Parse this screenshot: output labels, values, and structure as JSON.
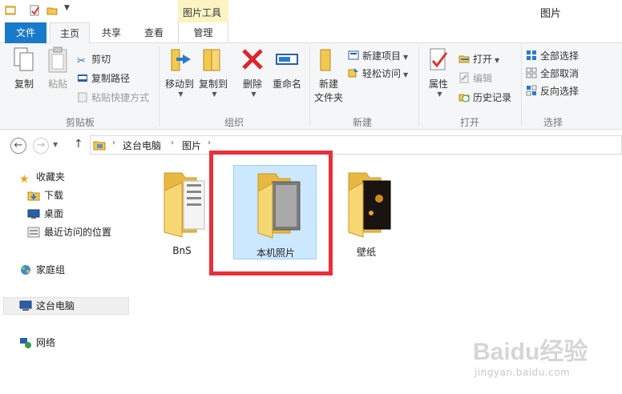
{
  "window": {
    "title": "图片",
    "context_tab_group": "图片工具"
  },
  "tabs": {
    "file": "文件",
    "home": "主页",
    "share": "共享",
    "view": "查看",
    "manage": "管理"
  },
  "ribbon": {
    "clipboard": {
      "label": "剪贴板",
      "copy": "复制",
      "paste": "粘贴",
      "cut": "剪切",
      "copy_path": "复制路径",
      "paste_shortcut": "粘贴快捷方式"
    },
    "organize": {
      "label": "组织",
      "move_to": "移动到",
      "copy_to": "复制到",
      "delete": "删除",
      "rename": "重命名"
    },
    "new": {
      "label": "新建",
      "new_folder_line1": "新建",
      "new_folder_line2": "文件夹",
      "new_item": "新建项目",
      "easy_access": "轻松访问"
    },
    "open": {
      "label": "打开",
      "properties": "属性",
      "open": "打开",
      "edit": "编辑",
      "history": "历史记录"
    },
    "select": {
      "label": "选择",
      "select_all": "全部选择",
      "select_none": "全部取消",
      "invert": "反向选择"
    }
  },
  "address": {
    "crumbs": [
      "这台电脑",
      "图片"
    ]
  },
  "nav": {
    "favorites": "收藏夹",
    "downloads": "下载",
    "desktop": "桌面",
    "recent": "最近访问的位置",
    "homegroup": "家庭组",
    "this_pc": "这台电脑",
    "network": "网络"
  },
  "folders": [
    {
      "name": "BnS"
    },
    {
      "name": "本机照片"
    },
    {
      "name": "壁纸"
    }
  ],
  "watermark": {
    "text": "Baidu经验",
    "sub": "jingyan.baidu.com"
  },
  "colors": {
    "accent": "#1979ca",
    "selection": "#cce8ff",
    "highlight": "#e8303a",
    "context_tab": "#fbf4c2"
  }
}
